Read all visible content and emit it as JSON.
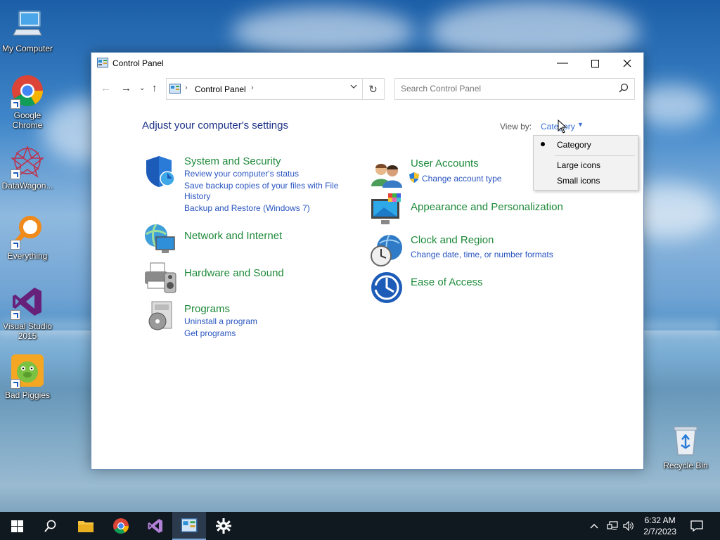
{
  "desktop": {
    "icons": [
      {
        "label": "My Computer"
      },
      {
        "label": "Google Chrome"
      },
      {
        "label": "DataWagon..."
      },
      {
        "label": "Everything"
      },
      {
        "label": "Visual Studio 2015"
      },
      {
        "label": "Bad Piggies"
      },
      {
        "label": "Recycle Bin"
      }
    ]
  },
  "window": {
    "title": "Control Panel",
    "address": {
      "crumb": "Control Panel"
    },
    "search": {
      "placeholder": "Search Control Panel"
    },
    "heading": "Adjust your computer's settings",
    "view_by": {
      "label": "View by:",
      "value": "Category"
    },
    "dropdown": {
      "options": [
        "Category",
        "Large icons",
        "Small icons"
      ],
      "selected": "Category"
    },
    "categories": {
      "system": {
        "title": "System and Security",
        "links": [
          "Review your computer's status",
          "Save backup copies of your files with File",
          "History",
          "Backup and Restore (Windows 7)"
        ]
      },
      "network": {
        "title": "Network and Internet",
        "links": []
      },
      "hardware": {
        "title": "Hardware and Sound",
        "links": []
      },
      "programs": {
        "title": "Programs",
        "links": [
          "Uninstall a program",
          "Get programs"
        ]
      },
      "users": {
        "title": "User Accounts",
        "links": [
          "Change account type"
        ]
      },
      "appearance": {
        "title": "Appearance and Personalization",
        "links": []
      },
      "clock": {
        "title": "Clock and Region",
        "links": [
          "Change date, time, or number formats"
        ]
      },
      "ease": {
        "title": "Ease of Access",
        "links": []
      }
    }
  },
  "taskbar": {
    "time": "6:32 AM",
    "date": "2/7/2023"
  },
  "colors": {
    "category_title": "#1e8a3a",
    "link": "#2a55c0",
    "heading": "#1e3287"
  }
}
